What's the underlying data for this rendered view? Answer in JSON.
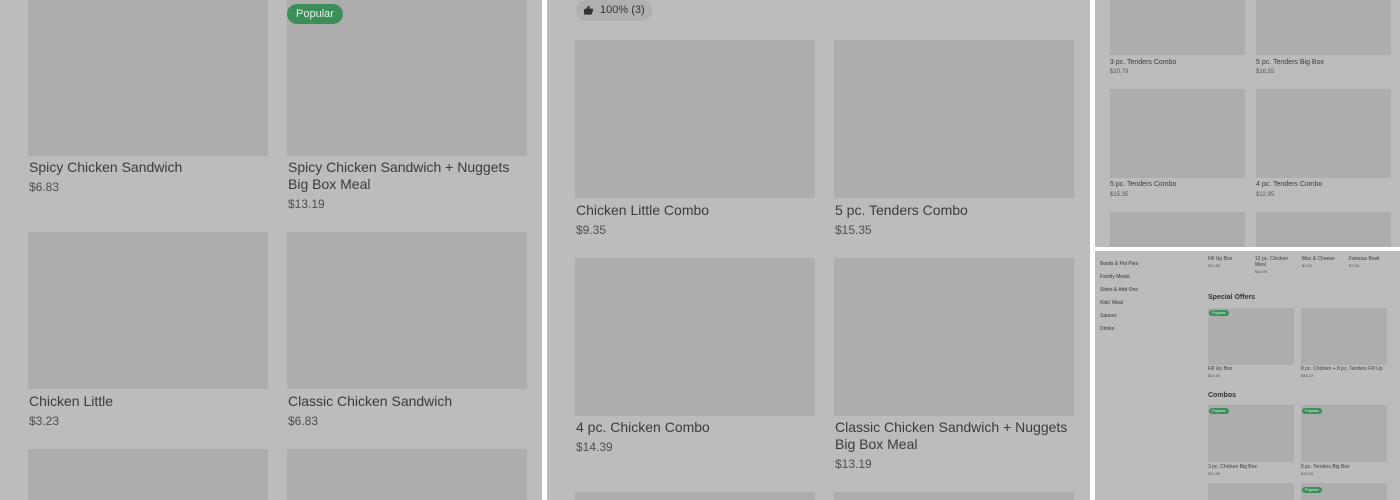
{
  "panel1": {
    "badge": "Popular",
    "items": [
      {
        "name": "Spicy Chicken Sandwich",
        "price": "$6.83"
      },
      {
        "name": "Spicy Chicken Sandwich + Nuggets Big Box Meal",
        "price": "$13.19"
      },
      {
        "name": "Chicken Little",
        "price": "$3.23"
      },
      {
        "name": "Classic Chicken Sandwich",
        "price": "$6.83"
      }
    ]
  },
  "panel2": {
    "rating": "100% (3)",
    "items": [
      {
        "name": "Chicken Little Combo",
        "price": "$9.35"
      },
      {
        "name": "5 pc. Tenders Combo",
        "price": "$15.35"
      },
      {
        "name": "4 pc. Chicken Combo",
        "price": "$14.39"
      },
      {
        "name": "Classic Chicken Sandwich + Nuggets Big Box Meal",
        "price": "$13.19"
      }
    ]
  },
  "panel3": {
    "items": [
      {
        "name": "3 pc. Tenders Combo",
        "price": "$10.79"
      },
      {
        "name": "5 pc. Tenders Big Box",
        "price": "$16.55"
      },
      {
        "name": "5 pc. Tenders Combo",
        "price": "$15.35"
      },
      {
        "name": "4 pc. Tenders Combo",
        "price": "$12.95"
      }
    ]
  },
  "panel4": {
    "nav": [
      "Bowls & Pot Pies",
      "Family Meals",
      "Sides & Add Ons",
      "Kids' Meal",
      "Sauces",
      "Drinks"
    ],
    "top_items": [
      {
        "name": "Fill Up Box",
        "price": "$24.00"
      },
      {
        "name": "12 pc. Chicken Meal",
        "price": "$44.99"
      },
      {
        "name": "Mac & Cheese",
        "price": "$3.83"
      },
      {
        "name": "Famous Bowl",
        "price": "$7.55"
      }
    ],
    "special_offers": {
      "title": "Special Offers",
      "badge": "Popular",
      "items": [
        {
          "name": "Fill Up Box",
          "price": "$24.00"
        },
        {
          "name": "8 pc. Chicken + 8 pc. Tenders Fill Up",
          "price": "$45.19"
        }
      ]
    },
    "combos": {
      "title": "Combos",
      "badge": "Popular",
      "items": [
        {
          "name": "3 pc. Chicken Big Box",
          "price": "$14.99"
        },
        {
          "name": "5 pc. Tenders Big Box",
          "price": "$16.55"
        }
      ]
    }
  },
  "colors": {
    "panel_bg": "#bcbcbc",
    "thumb_bg": "#adadad",
    "badge_green": "#3d8e5a"
  }
}
